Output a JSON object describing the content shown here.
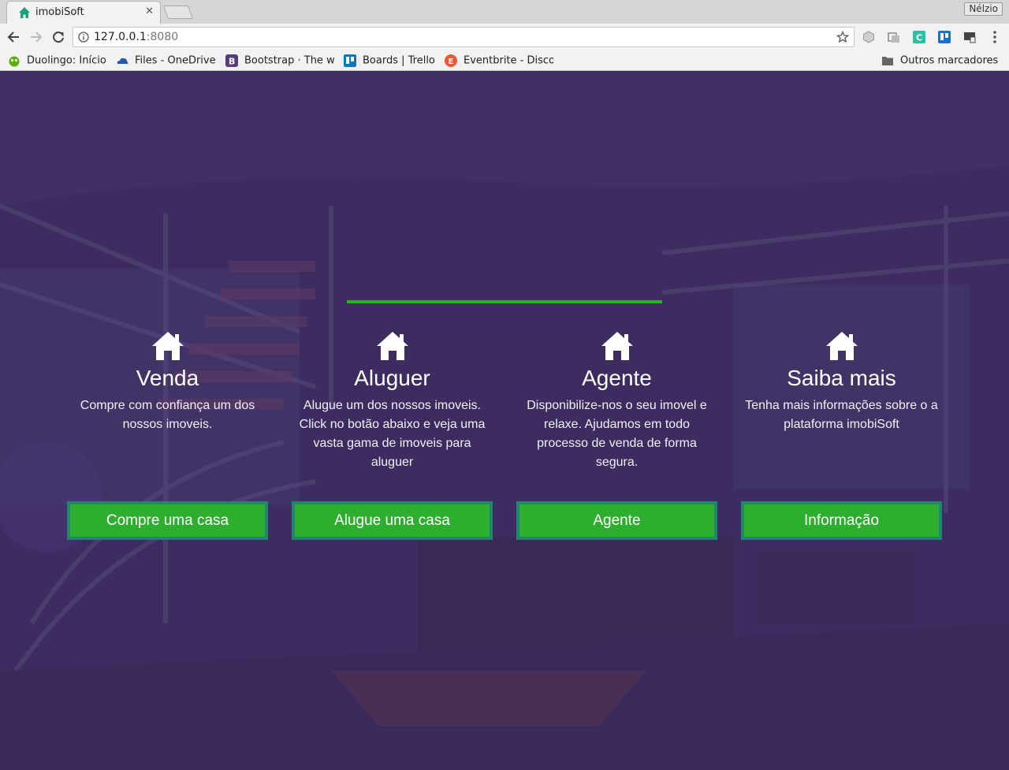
{
  "browser": {
    "tab_title": "imobiSoft",
    "profile_name": "Nélzio",
    "url_host": "127.0.0.1",
    "url_port": ":8080",
    "bookmarks": [
      {
        "label": "Duolingo: Início",
        "icon": "duolingo-icon"
      },
      {
        "label": "Files - OneDrive",
        "icon": "onedrive-icon"
      },
      {
        "label": "Bootstrap · The w",
        "icon": "bootstrap-icon"
      },
      {
        "label": "Boards | Trello",
        "icon": "trello-icon"
      },
      {
        "label": "Eventbrite - Disco",
        "icon": "eventbrite-icon"
      }
    ],
    "other_bookmarks": "Outros marcadores"
  },
  "page": {
    "accent_color": "#2eae2e",
    "features": [
      {
        "title": "Venda",
        "description": "Compre com confiança um dos nossos imoveis.",
        "button": "Compre uma casa",
        "icon": "house-icon"
      },
      {
        "title": "Aluguer",
        "description": "Alugue um dos nossos imoveis. Click no botão abaixo e veja uma vasta gama de imoveis para aluguer",
        "button": "Alugue uma casa",
        "icon": "house-icon"
      },
      {
        "title": "Agente",
        "description": "Disponibilize-nos o seu imovel e relaxe. Ajudamos em todo processo de venda de forma segura.",
        "button": "Agente",
        "icon": "house-icon"
      },
      {
        "title": "Saiba mais",
        "description": "Tenha mais informações sobre o a plataforma imobiSoft",
        "button": "Informação",
        "icon": "house-icon"
      }
    ]
  }
}
